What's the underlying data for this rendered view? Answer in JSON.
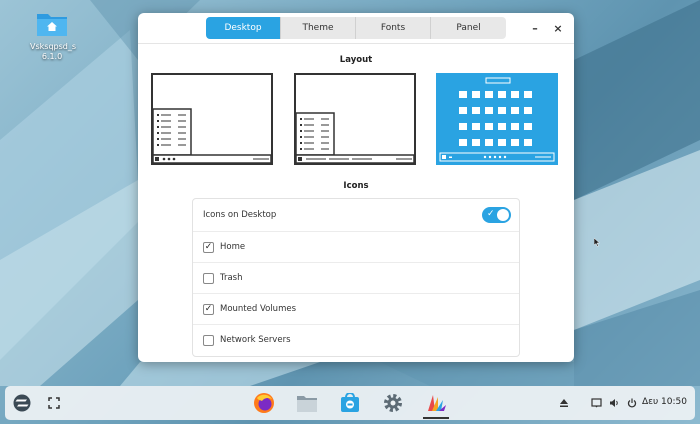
{
  "desktop": {
    "icon_label": "Vsksqpsd_s 6.1.0",
    "icon_name": "home-folder-icon"
  },
  "window": {
    "tabs": [
      {
        "label": "Desktop",
        "active": true
      },
      {
        "label": "Theme",
        "active": false
      },
      {
        "label": "Fonts",
        "active": false
      },
      {
        "label": "Panel",
        "active": false
      }
    ],
    "minimize": "–",
    "close": "×",
    "layout_title": "Layout",
    "icons_title": "Icons",
    "icons_on_desktop_label": "Icons on Desktop",
    "icons_on_desktop_enabled": true,
    "icon_options": [
      {
        "label": "Home",
        "checked": true
      },
      {
        "label": "Trash",
        "checked": false
      },
      {
        "label": "Mounted Volumes",
        "checked": true
      },
      {
        "label": "Network Servers",
        "checked": false
      }
    ],
    "selected_layout": 3
  },
  "taskbar": {
    "clock": "Δευ 10:50",
    "apps": [
      "firefox-icon",
      "files-icon",
      "software-icon",
      "settings-icon",
      "appearance-icon"
    ],
    "active_app": "appearance-icon"
  },
  "colors": {
    "accent": "#2aa3e2"
  }
}
